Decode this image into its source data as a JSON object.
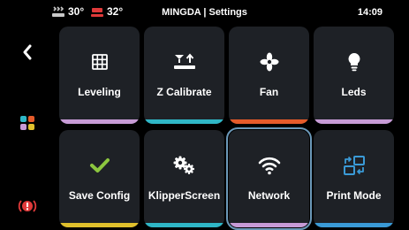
{
  "status": {
    "bed_temp": "30°",
    "nozzle_temp": "32°",
    "title": "MINGDA | Settings",
    "time": "14:09"
  },
  "sidebar": {
    "back_icon": "chevron-left-icon",
    "home_icon": "main-menu-icon",
    "estop_icon": "emergency-stop-icon"
  },
  "menu": {
    "items": [
      {
        "label": "Leveling",
        "icon": "grid-icon",
        "stripe": "#c79bd6"
      },
      {
        "label": "Z Calibrate",
        "icon": "z-calibrate-icon",
        "stripe": "#2fb6c6"
      },
      {
        "label": "Fan",
        "icon": "fan-icon",
        "stripe": "#e55b2a"
      },
      {
        "label": "Leds",
        "icon": "bulb-icon",
        "stripe": "#c79bd6"
      },
      {
        "label": "Save Config",
        "icon": "checkmark-icon",
        "stripe": "#e0c02c"
      },
      {
        "label": "KlipperScreen",
        "icon": "gears-icon",
        "stripe": "#2fb6c6"
      },
      {
        "label": "Network",
        "icon": "wifi-icon",
        "stripe": "#c79bd6",
        "selected": true
      },
      {
        "label": "Print Mode",
        "icon": "print-mode-icon",
        "stripe": "#3a9ad6"
      }
    ]
  }
}
